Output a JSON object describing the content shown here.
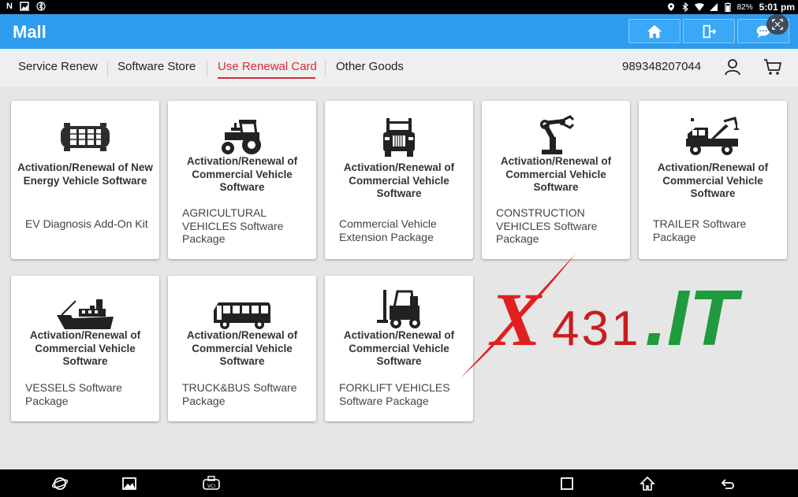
{
  "status_bar": {
    "battery": "82%",
    "time": "5:01 pm"
  },
  "app": {
    "title": "Mall"
  },
  "tabs": [
    {
      "label": "Service Renew"
    },
    {
      "label": "Software Store"
    },
    {
      "label": "Use Renewal Card"
    },
    {
      "label": "Other Goods"
    }
  ],
  "active_tab": "Use Renewal Card",
  "account": {
    "phone": "989348207044"
  },
  "cards": [
    {
      "icon": "ev-battery-icon",
      "heading": "Activation/Renewal of New Energy Vehicle Software",
      "desc": "EV Diagnosis Add-On Kit"
    },
    {
      "icon": "tractor-icon",
      "heading": "Activation/Renewal of Commercial Vehicle Software",
      "desc": "AGRICULTURAL VEHICLES Software Package"
    },
    {
      "icon": "truck-front-icon",
      "heading": "Activation/Renewal of Commercial Vehicle Software",
      "desc": "Commercial Vehicle Extension Package"
    },
    {
      "icon": "robot-arm-icon",
      "heading": "Activation/Renewal of Commercial Vehicle Software",
      "desc": "CONSTRUCTION VEHICLES Software Package"
    },
    {
      "icon": "tow-truck-icon",
      "heading": "Activation/Renewal of Commercial Vehicle Software",
      "desc": "TRAILER Software Package"
    },
    {
      "icon": "ship-icon",
      "heading": "Activation/Renewal of Commercial Vehicle Software",
      "desc": "VESSELS Software Package"
    },
    {
      "icon": "bus-icon",
      "heading": "Activation/Renewal of Commercial Vehicle Software",
      "desc": "TRUCK&BUS Software Package"
    },
    {
      "icon": "forklift-icon",
      "heading": "Activation/Renewal of Commercial Vehicle Software",
      "desc": "FORKLIFT VEHICLES Software Package"
    }
  ],
  "watermark": {
    "text_x": "X",
    "text_num": "431",
    "text_it": ".IT"
  },
  "colors": {
    "app_bar": "#2d9cf0",
    "active_tab": "#d72c3c",
    "watermark_red": "#e02020",
    "watermark_green": "#1f9a3c"
  }
}
